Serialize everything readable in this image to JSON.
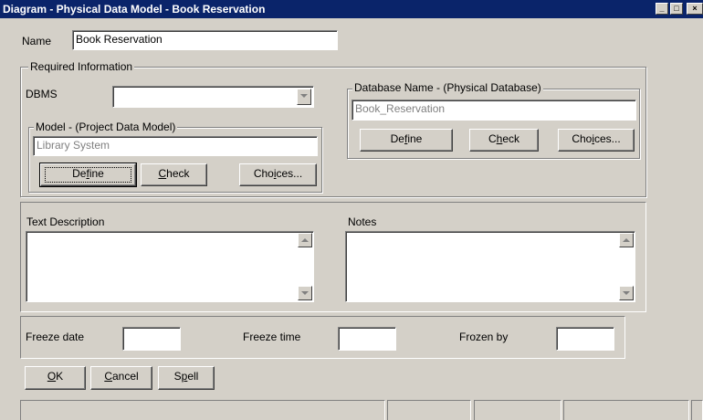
{
  "window": {
    "title": "Diagram - Physical Data Model - Book Reservation"
  },
  "name": {
    "label": "Name",
    "value": "Book Reservation"
  },
  "required": {
    "legend": "Required Information",
    "dbms_label": "DBMS",
    "dbms_value": "",
    "model": {
      "legend": "Model - (Project Data Model)",
      "value": "Library System",
      "define": {
        "pre": "De",
        "u": "f",
        "post": "ine"
      },
      "check": {
        "pre": "",
        "u": "C",
        "post": "heck"
      },
      "choices": {
        "pre": "Cho",
        "u": "i",
        "post": "ces..."
      }
    },
    "database": {
      "legend": "Database Name - (Physical Database)",
      "value": "Book_Reservation",
      "define": {
        "pre": "De",
        "u": "f",
        "post": "ine"
      },
      "check": {
        "pre": "C",
        "u": "h",
        "post": "eck"
      },
      "choices": {
        "pre": "Cho",
        "u": "i",
        "post": "ces..."
      }
    }
  },
  "text_description": {
    "label": "Text Description",
    "value": ""
  },
  "notes": {
    "label": "Notes",
    "value": ""
  },
  "freeze": {
    "date_label": "Freeze date",
    "date_value": "",
    "time_label": "Freeze time",
    "time_value": "",
    "by_label": "Frozen by",
    "by_value": ""
  },
  "buttons": {
    "ok": {
      "pre": "",
      "u": "O",
      "post": "K"
    },
    "cancel": {
      "pre": "",
      "u": "C",
      "post": "ancel"
    },
    "spell": {
      "pre": "S",
      "u": "p",
      "post": "ell"
    }
  }
}
